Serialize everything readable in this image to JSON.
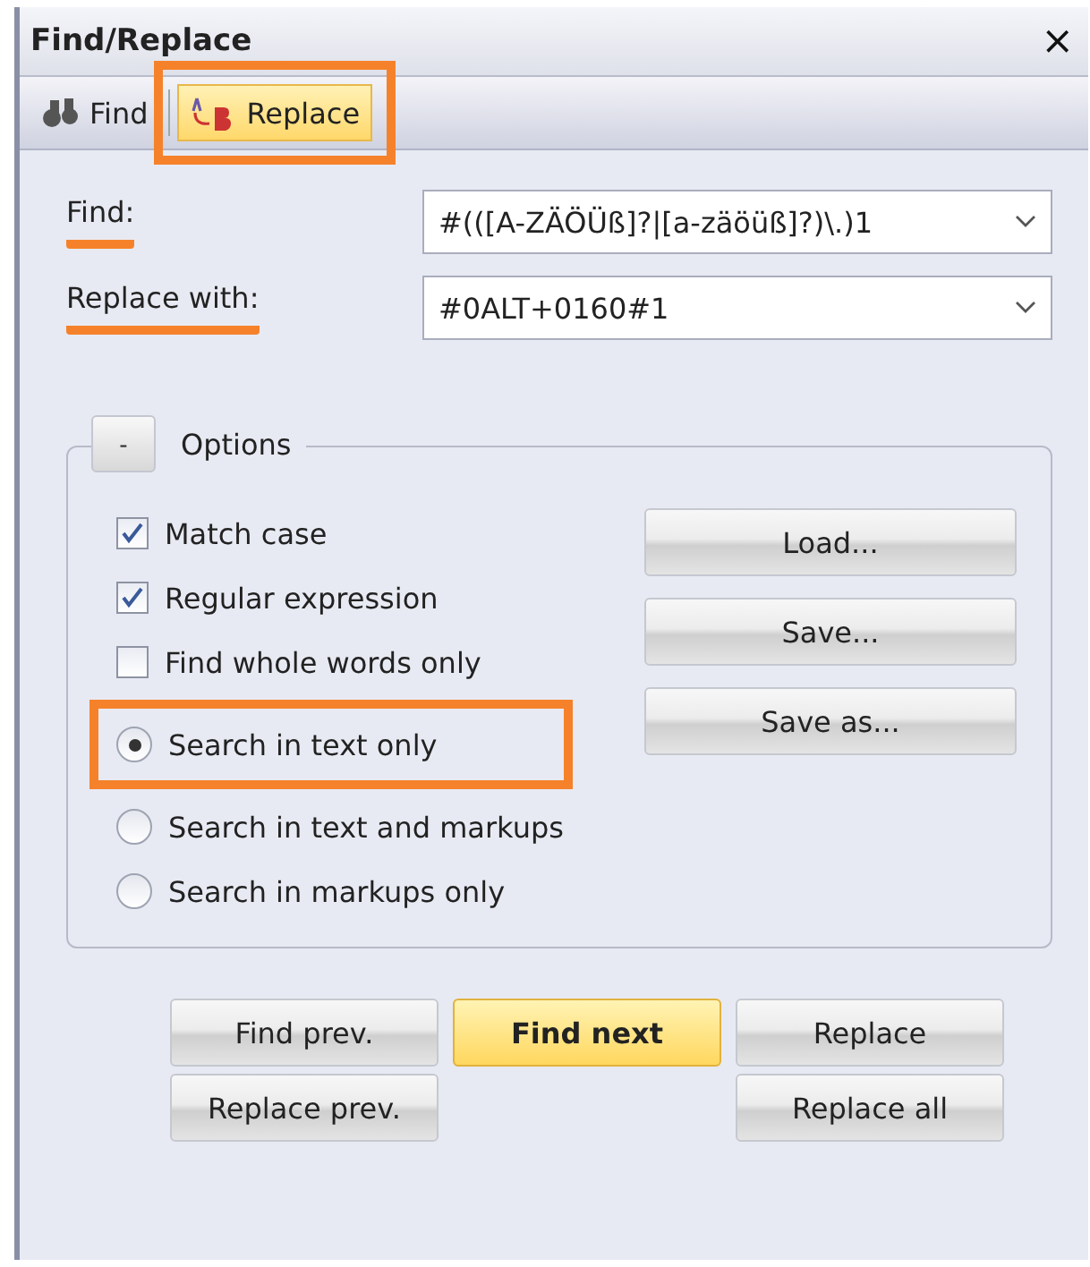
{
  "window": {
    "title": "Find/Replace",
    "close": "×"
  },
  "tabs": [
    {
      "label": "Find",
      "selected": false,
      "highlighted": false
    },
    {
      "label": "Replace",
      "selected": true,
      "highlighted": true
    }
  ],
  "fields": [
    {
      "label": "Find:",
      "value": "#(([A-ZÄÖÜß]?|[a-zäöüß]?)\\.)1",
      "highlighted": true
    },
    {
      "label": "Replace with:",
      "value": "#0ALT+0160#1",
      "highlighted": true
    }
  ],
  "options": {
    "toggle": "-",
    "title": "Options",
    "items": [
      {
        "kind": "checkbox",
        "label": "Match case",
        "checked": true,
        "highlighted": false
      },
      {
        "kind": "checkbox",
        "label": "Regular expression",
        "checked": true,
        "highlighted": false
      },
      {
        "kind": "checkbox",
        "label": "Find whole words only",
        "checked": false,
        "highlighted": false
      },
      {
        "kind": "radio",
        "label": "Search in text only",
        "selected": true,
        "highlighted": true
      },
      {
        "kind": "radio",
        "label": "Search in text and markups",
        "selected": false,
        "highlighted": false
      },
      {
        "kind": "radio",
        "label": "Search in markups only",
        "selected": false,
        "highlighted": false
      }
    ],
    "buttons": [
      "Load...",
      "Save...",
      "Save as..."
    ]
  },
  "actions": [
    {
      "label": "Find prev.",
      "default": false
    },
    {
      "label": "Find next",
      "default": true
    },
    {
      "label": "Replace",
      "default": false
    },
    {
      "label": "Replace prev.",
      "default": false
    },
    {
      "label": "Replace all",
      "default": false
    }
  ]
}
